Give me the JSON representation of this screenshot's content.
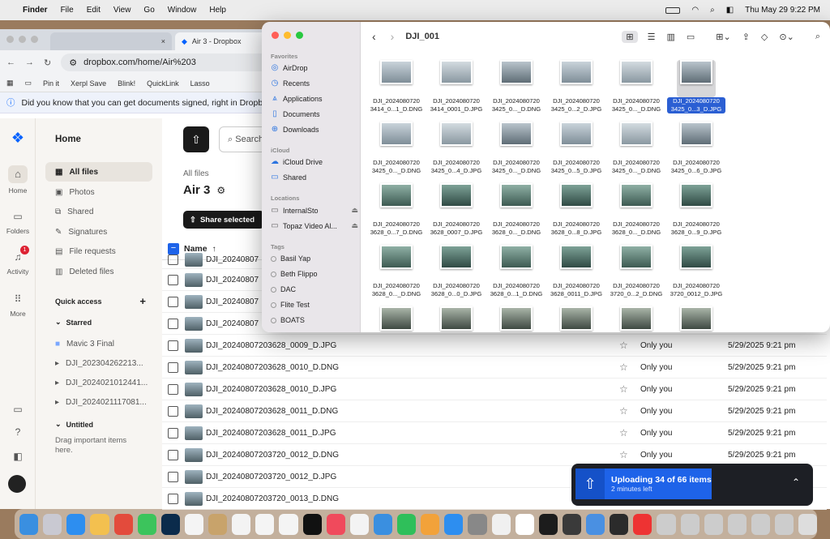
{
  "menubar": {
    "app": "Finder",
    "items": [
      "File",
      "Edit",
      "View",
      "Go",
      "Window",
      "Help"
    ],
    "clock": "Thu May 29  9:22 PM"
  },
  "browser": {
    "tab_inactive": "",
    "tab_active": "Air 3 - Dropbox",
    "url": "dropbox.com/home/Air%203",
    "bookmarks": [
      "Pin it",
      "Xerpl Save",
      "Blink!",
      "QuickLink",
      "Lasso"
    ],
    "banner": "Did you know that you can get documents signed, right in Dropbox"
  },
  "dropbox": {
    "rail": [
      {
        "label": "Home"
      },
      {
        "label": "Folders"
      },
      {
        "label": "Activity",
        "badge": "1"
      },
      {
        "label": "More"
      }
    ],
    "sidebar_title": "Home",
    "nav": [
      "All files",
      "Photos",
      "Shared",
      "Signatures",
      "File requests",
      "Deleted files"
    ],
    "quick_access": "Quick access",
    "starred": "Starred",
    "starred_items": [
      "Mavic 3 Final",
      "DJI_202304262213...",
      "DJI_2024021012441...",
      "DJI_2024021117081..."
    ],
    "untitled": "Untitled",
    "drag_hint": "Drag important items here.",
    "breadcrumb": "All files",
    "folder_title": "Air 3",
    "share_btn": "Share selected",
    "search_placeholder": "Search",
    "col_name": "Name",
    "partial_rows": [
      "DJI_20240807",
      "DJI_20240807",
      "DJI_20240807",
      "DJI_20240807"
    ],
    "rows": [
      {
        "name": "DJI_20240807203628_0009_D.JPG",
        "who": "Only you",
        "date": "5/29/2025 9:21 pm"
      },
      {
        "name": "DJI_20240807203628_0010_D.DNG",
        "who": "Only you",
        "date": "5/29/2025 9:21 pm"
      },
      {
        "name": "DJI_20240807203628_0010_D.JPG",
        "who": "Only you",
        "date": "5/29/2025 9:21 pm"
      },
      {
        "name": "DJI_20240807203628_0011_D.DNG",
        "who": "Only you",
        "date": "5/29/2025 9:21 pm"
      },
      {
        "name": "DJI_20240807203628_0011_D.JPG",
        "who": "Only you",
        "date": "5/29/2025 9:21 pm"
      },
      {
        "name": "DJI_20240807203720_0012_D.DNG",
        "who": "Only you",
        "date": "5/29/2025 9:21 pm"
      },
      {
        "name": "DJI_20240807203720_0012_D.JPG",
        "who": "Only you",
        "date": "5/29/2025 9:21 pm"
      },
      {
        "name": "DJI_20240807203720_0013_D.DNG",
        "who": "Only you",
        "date": "5/29/2025 9:21 pm"
      }
    ]
  },
  "finder": {
    "title": "DJI_001",
    "favorites_label": "Favorites",
    "favorites": [
      "AirDrop",
      "Recents",
      "Applications",
      "Documents",
      "Downloads"
    ],
    "icloud_label": "iCloud",
    "icloud": [
      "iCloud Drive",
      "Shared"
    ],
    "locations_label": "Locations",
    "locations": [
      "InternalSto",
      "Topaz Video Al..."
    ],
    "tags_label": "Tags",
    "tags": [
      "Basil Yap",
      "Beth Flippo",
      "DAC",
      "Flite Test",
      "BOATS"
    ],
    "files": [
      [
        "DJI_2024080720",
        "3414_0...1_D.DNG"
      ],
      [
        "DJI_2024080720",
        "3414_0001_D.JPG"
      ],
      [
        "DJI_2024080720",
        "3425_0..._D.DNG"
      ],
      [
        "DJI_2024080720",
        "3425_0...2_D.JPG"
      ],
      [
        "DJI_2024080720",
        "3425_0..._D.DNG"
      ],
      [
        "DJI_2024080720",
        "3425_0...3_D.JPG"
      ],
      [
        "DJI_2024080720",
        "3425_0..._D.DNG"
      ],
      [
        "DJI_2024080720",
        "3425_0...4_D.JPG"
      ],
      [
        "DJI_2024080720",
        "3425_0..._D.DNG"
      ],
      [
        "DJI_2024080720",
        "3425_0...5_D.JPG"
      ],
      [
        "DJI_2024080720",
        "3425_0..._D.DNG"
      ],
      [
        "DJI_2024080720",
        "3425_0...6_D.JPG"
      ],
      [
        "DJI_2024080720",
        "3628_0...7_D.DNG"
      ],
      [
        "DJI_2024080720",
        "3628_0007_D.JPG"
      ],
      [
        "DJI_2024080720",
        "3628_0..._D.DNG"
      ],
      [
        "DJI_2024080720",
        "3628_0...8_D.JPG"
      ],
      [
        "DJI_2024080720",
        "3628_0..._D.DNG"
      ],
      [
        "DJI_2024080720",
        "3628_0...9_D.JPG"
      ],
      [
        "DJI_2024080720",
        "3628_0..._D.DNG"
      ],
      [
        "DJI_2024080720",
        "3628_0...0_D.JPG"
      ],
      [
        "DJI_2024080720",
        "3628_0...1_D.DNG"
      ],
      [
        "DJI_2024080720",
        "3628_0011_D.JPG"
      ],
      [
        "DJI_2024080720",
        "3720_0...2_D.DNG"
      ],
      [
        "DJI_2024080720",
        "3720_0012_D.JPG"
      ]
    ]
  },
  "upload": {
    "title": "Uploading 34 of 66 items",
    "subtitle": "2 minutes left"
  }
}
